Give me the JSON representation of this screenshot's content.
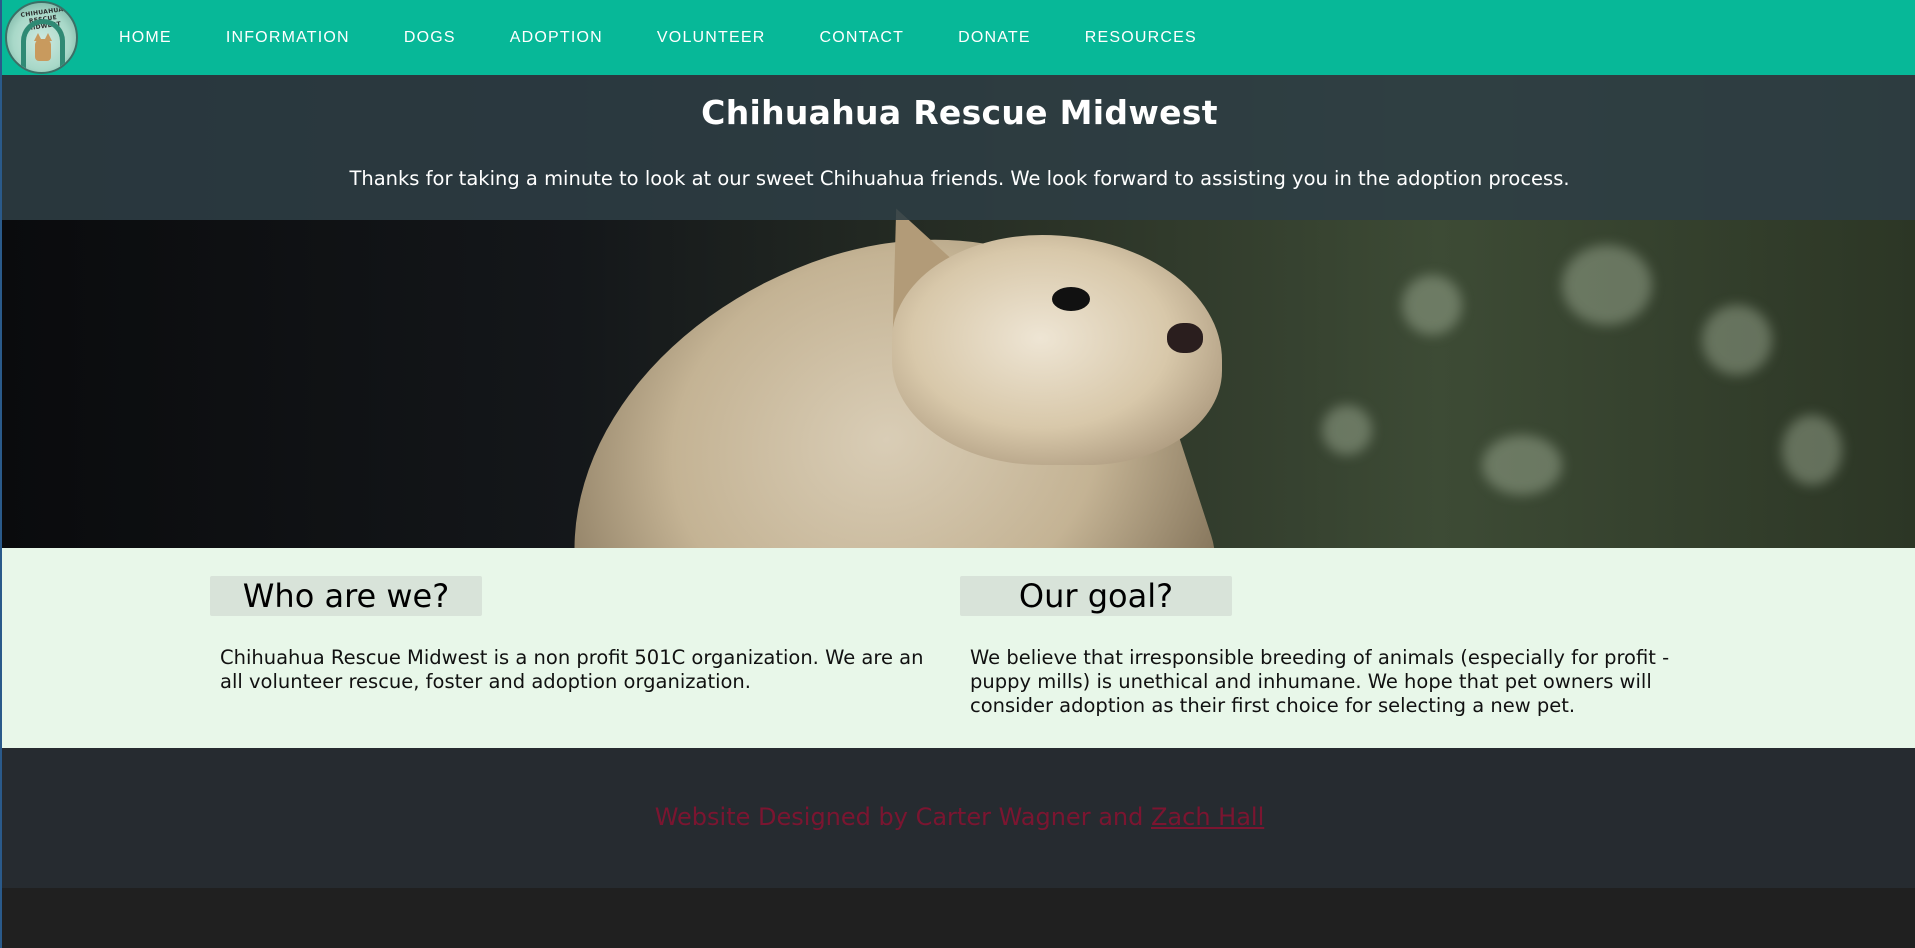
{
  "nav": {
    "logo_text": "CHIHUAHUA RESCUE MIDWEST",
    "items": [
      {
        "label": "HOME"
      },
      {
        "label": "INFORMATION"
      },
      {
        "label": "DOGS"
      },
      {
        "label": "ADOPTION"
      },
      {
        "label": "VOLUNTEER"
      },
      {
        "label": "CONTACT"
      },
      {
        "label": "DONATE"
      },
      {
        "label": "RESOURCES"
      }
    ]
  },
  "hero": {
    "title": "Chihuahua Rescue Midwest",
    "subtitle": "Thanks for taking a minute to look at our sweet Chihuahua friends. We look forward to assisting you in the adoption process."
  },
  "about": {
    "who": {
      "heading": "Who are we?",
      "text": "Chihuahua Rescue Midwest is a non profit 501C organization. We are an all volunteer rescue, foster and adoption organization."
    },
    "goal": {
      "heading": "Our goal?",
      "text": "We believe that irresponsible breeding of animals (especially for profit - puppy mills) is unethical and inhumane. We hope that pet owners will consider adoption as their first choice for selecting a new pet."
    }
  },
  "footer": {
    "credit_prefix": "Website Designed by Carter Wagner and ",
    "credit_link": "Zach Hall"
  },
  "colors": {
    "nav_bg": "#07b898",
    "about_bg": "#e8f7e9",
    "footer_bg": "#262b30",
    "footer_text": "#7b1530"
  }
}
